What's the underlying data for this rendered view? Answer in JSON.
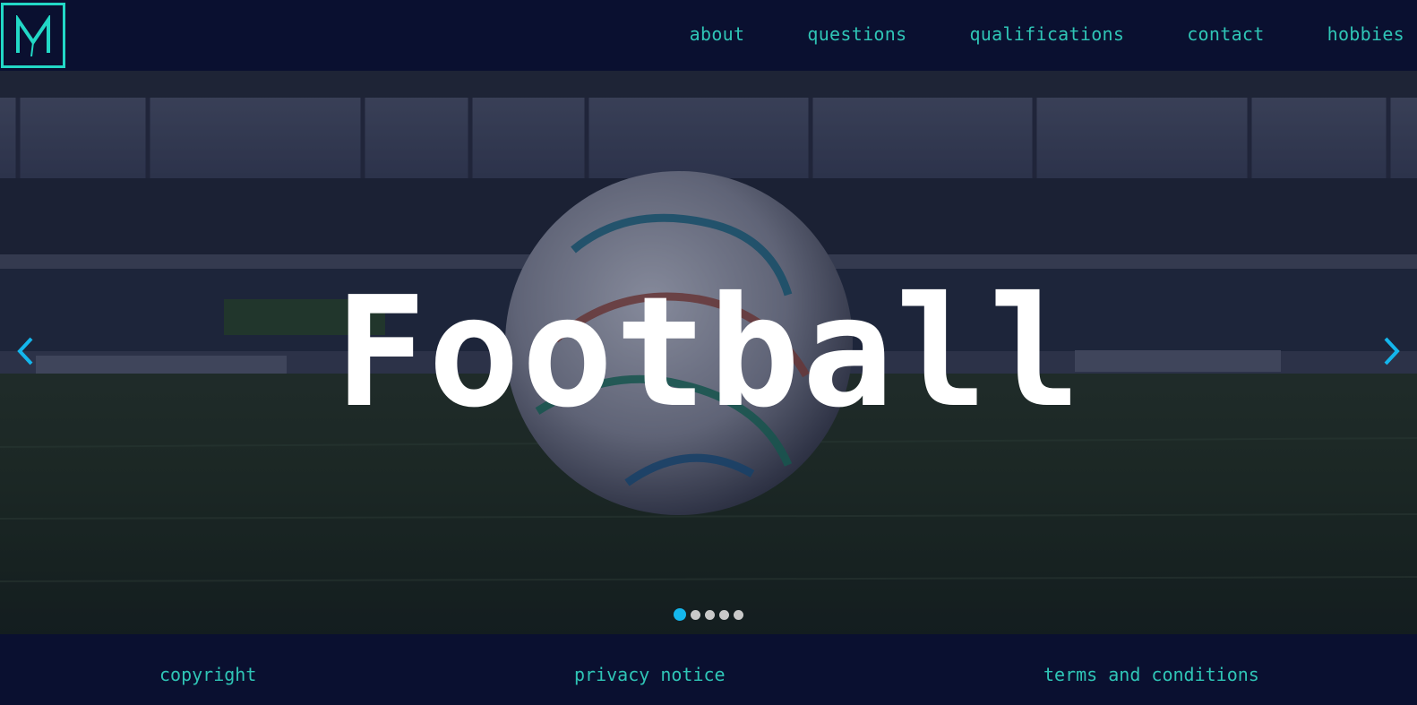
{
  "logo": {
    "letter": "M",
    "icon": "m-logo-icon",
    "color": "#22d8c6"
  },
  "nav": {
    "items": [
      {
        "label": "about"
      },
      {
        "label": "questions"
      },
      {
        "label": "qualifications"
      },
      {
        "label": "contact"
      },
      {
        "label": "hobbies"
      }
    ]
  },
  "hero": {
    "title": "Football",
    "prev_icon": "chevron-left-icon",
    "next_icon": "chevron-right-icon",
    "slides_total": 5,
    "active_slide": 1
  },
  "footer": {
    "copyright": "copyright",
    "privacy": "privacy notice",
    "terms": "terms and conditions"
  },
  "colors": {
    "background": "#0a1030",
    "accent": "#2fc5b6",
    "arrow": "#14b6ec"
  }
}
